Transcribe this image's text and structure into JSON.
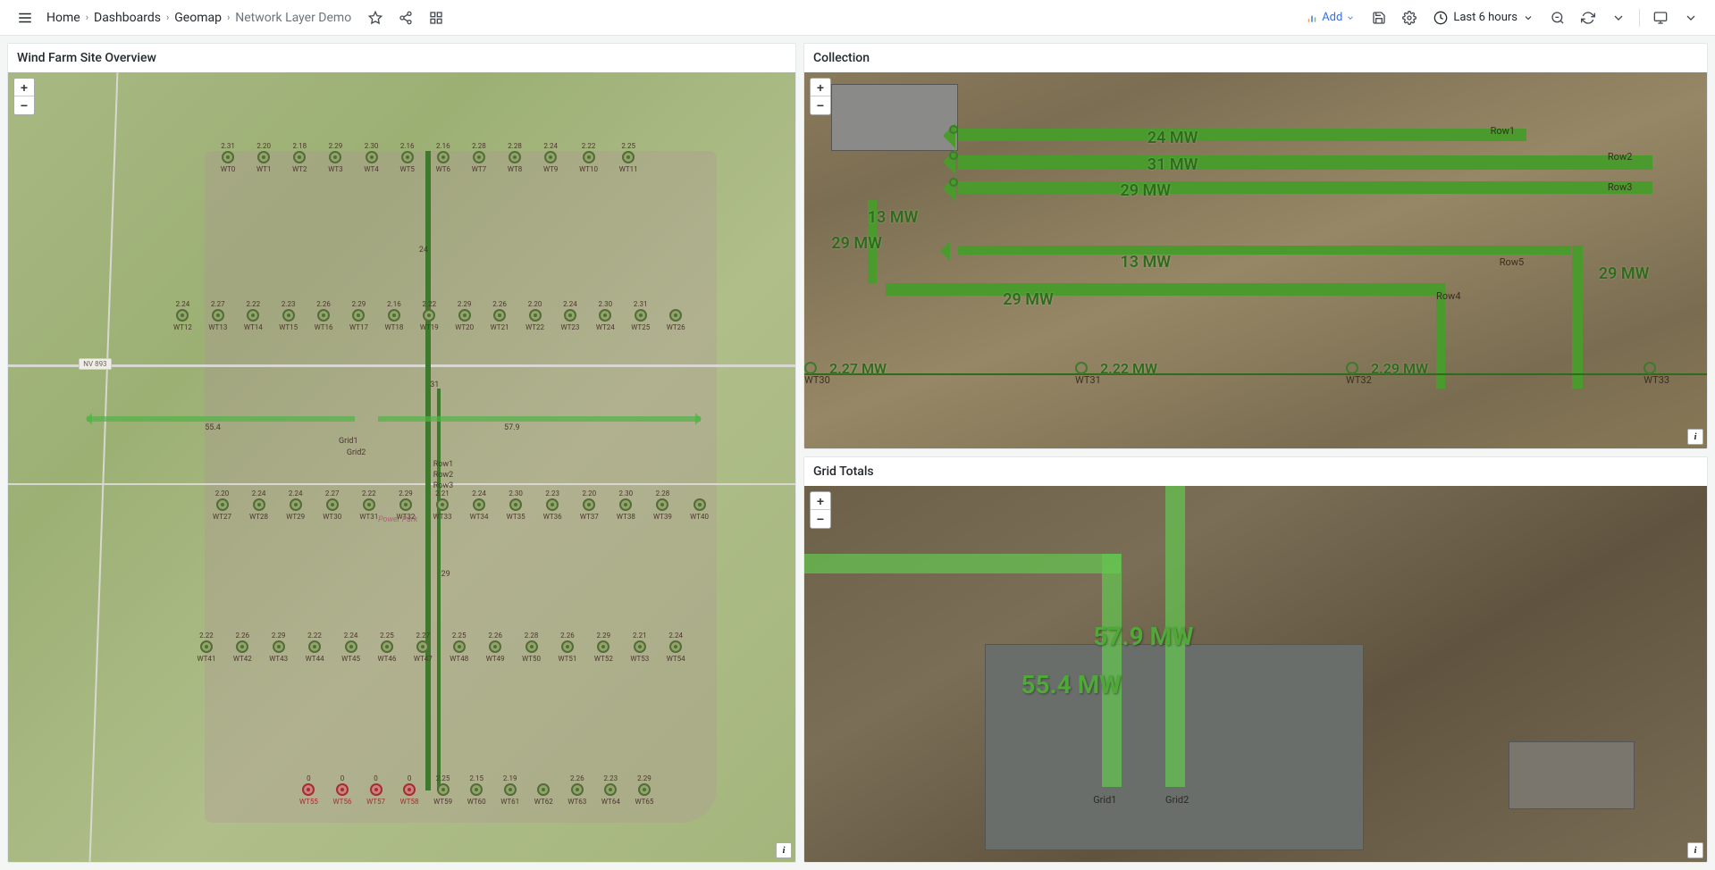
{
  "breadcrumbs": {
    "home": "Home",
    "dashboards": "Dashboards",
    "geomap": "Geomap",
    "current": "Network Layer Demo"
  },
  "toolbar": {
    "add": "Add",
    "time_range": "Last 6 hours"
  },
  "panels": {
    "overview": {
      "title": "Wind Farm Site Overview",
      "road_label": "NV 893",
      "center_labels": {
        "grid1": "Grid1",
        "grid2": "Grid2",
        "row1": "Row1",
        "row2": "Row2",
        "row3": "Row3",
        "power_park": "Power Park"
      },
      "harrow_left": "55.4",
      "harrow_right": "57.9",
      "vlabels": {
        "a": "24",
        "b": "31",
        "c": "29"
      },
      "rows": [
        {
          "top": "10%",
          "turbines": [
            {
              "lbl": "WT0",
              "val": "2.31"
            },
            {
              "lbl": "WT1",
              "val": "2.20"
            },
            {
              "lbl": "WT2",
              "val": "2.18"
            },
            {
              "lbl": "WT3",
              "val": "2.29"
            },
            {
              "lbl": "WT4",
              "val": "2.30"
            },
            {
              "lbl": "WT5",
              "val": "2.16"
            },
            {
              "lbl": "WT6",
              "val": "2.16"
            },
            {
              "lbl": "WT7",
              "val": "2.28"
            },
            {
              "lbl": "WT8",
              "val": "2.28"
            },
            {
              "lbl": "WT9",
              "val": "2.24"
            },
            {
              "lbl": "WT10",
              "val": "2.22"
            },
            {
              "lbl": "WT11",
              "val": "2.25"
            }
          ],
          "left": "27%",
          "right": "20%"
        },
        {
          "top": "30%",
          "turbines": [
            {
              "lbl": "WT12",
              "val": "2.24"
            },
            {
              "lbl": "WT13",
              "val": "2.27"
            },
            {
              "lbl": "WT14",
              "val": "2.22"
            },
            {
              "lbl": "WT15",
              "val": "2.23"
            },
            {
              "lbl": "WT16",
              "val": "2.26"
            },
            {
              "lbl": "WT17",
              "val": "2.29"
            },
            {
              "lbl": "WT18",
              "val": "2.16"
            },
            {
              "lbl": "WT19",
              "val": "2.22"
            },
            {
              "lbl": "WT20",
              "val": "2.29"
            },
            {
              "lbl": "WT21",
              "val": "2.26"
            },
            {
              "lbl": "WT22",
              "val": "2.20"
            },
            {
              "lbl": "WT23",
              "val": "2.24"
            },
            {
              "lbl": "WT24",
              "val": "2.30"
            },
            {
              "lbl": "WT25",
              "val": "2.31"
            },
            {
              "lbl": "WT26",
              "val": ""
            }
          ],
          "left": "21%",
          "right": "14%"
        },
        {
          "top": "54%",
          "turbines": [
            {
              "lbl": "WT27",
              "val": "2.20"
            },
            {
              "lbl": "WT28",
              "val": "2.24"
            },
            {
              "lbl": "WT29",
              "val": "2.24"
            },
            {
              "lbl": "WT30",
              "val": "2.27"
            },
            {
              "lbl": "WT31",
              "val": "2.22"
            },
            {
              "lbl": "WT32",
              "val": "2.29"
            },
            {
              "lbl": "WT33",
              "val": "2.21"
            },
            {
              "lbl": "WT34",
              "val": "2.24"
            },
            {
              "lbl": "WT35",
              "val": "2.30"
            },
            {
              "lbl": "WT36",
              "val": "2.23"
            },
            {
              "lbl": "WT37",
              "val": "2.20"
            },
            {
              "lbl": "WT38",
              "val": "2.30"
            },
            {
              "lbl": "WT39",
              "val": "2.28"
            },
            {
              "lbl": "WT40",
              "val": ""
            }
          ],
          "left": "26%",
          "right": "11%"
        },
        {
          "top": "72%",
          "turbines": [
            {
              "lbl": "WT41",
              "val": "2.22"
            },
            {
              "lbl": "WT42",
              "val": "2.26"
            },
            {
              "lbl": "WT43",
              "val": "2.29"
            },
            {
              "lbl": "WT44",
              "val": "2.22"
            },
            {
              "lbl": "WT45",
              "val": "2.24"
            },
            {
              "lbl": "WT46",
              "val": "2.25"
            },
            {
              "lbl": "WT47",
              "val": "2.27"
            },
            {
              "lbl": "WT48",
              "val": "2.25"
            },
            {
              "lbl": "WT49",
              "val": "2.26"
            },
            {
              "lbl": "WT50",
              "val": "2.28"
            },
            {
              "lbl": "WT51",
              "val": "2.26"
            },
            {
              "lbl": "WT52",
              "val": "2.29"
            },
            {
              "lbl": "WT53",
              "val": "2.21"
            },
            {
              "lbl": "WT54",
              "val": "2.24"
            }
          ],
          "left": "24%",
          "right": "14%"
        },
        {
          "top": "90%",
          "turbines": [
            {
              "lbl": "WT55",
              "val": "0",
              "red": true
            },
            {
              "lbl": "WT56",
              "val": "0",
              "red": true
            },
            {
              "lbl": "WT57",
              "val": "0",
              "red": true
            },
            {
              "lbl": "WT58",
              "val": "0",
              "red": true
            },
            {
              "lbl": "WT59",
              "val": "2.25"
            },
            {
              "lbl": "WT60",
              "val": "2.15"
            },
            {
              "lbl": "WT61",
              "val": "2.19"
            },
            {
              "lbl": "WT62",
              "val": ""
            },
            {
              "lbl": "WT63",
              "val": "2.26"
            },
            {
              "lbl": "WT64",
              "val": "2.23"
            },
            {
              "lbl": "WT65",
              "val": "2.29"
            }
          ],
          "left": "37%",
          "right": "18%",
          "half_red": true
        }
      ]
    },
    "collection": {
      "title": "Collection",
      "flows": [
        {
          "label": "24 MW",
          "top": "15%",
          "left": "38%"
        },
        {
          "label": "31 MW",
          "top": "22%",
          "left": "38%"
        },
        {
          "label": "29 MW",
          "top": "29%",
          "left": "35%"
        },
        {
          "label": "13 MW",
          "top": "36%",
          "left": "7%"
        },
        {
          "label": "29 MW",
          "top": "43%",
          "left": "3%"
        },
        {
          "label": "13 MW",
          "top": "48%",
          "left": "35%"
        },
        {
          "label": "29 MW",
          "top": "58%",
          "left": "22%"
        },
        {
          "label": "29 MW",
          "top": "51%",
          "left": "88%"
        }
      ],
      "row_tags": [
        {
          "t": "Row1",
          "top": "14%",
          "left": "76%"
        },
        {
          "t": "Row2",
          "top": "21%",
          "left": "89%"
        },
        {
          "t": "Row3",
          "top": "29%",
          "left": "89%"
        },
        {
          "t": "Row5",
          "top": "49%",
          "left": "77%"
        },
        {
          "t": "Row4",
          "top": "58%",
          "left": "70%"
        }
      ],
      "bottom_row": [
        {
          "lbl": "WT30",
          "val": "2.27 MW",
          "left": "0%"
        },
        {
          "lbl": "WT31",
          "val": "2.22 MW",
          "left": "30%"
        },
        {
          "lbl": "WT32",
          "val": "2.29 MW",
          "left": "60%"
        },
        {
          "lbl": "WT33",
          "val": "",
          "left": "93%"
        }
      ]
    },
    "grid_totals": {
      "title": "Grid Totals",
      "flows": [
        {
          "label": "57.9 MW",
          "top": "36%",
          "left": "32%"
        },
        {
          "label": "55.4 MW",
          "top": "49%",
          "left": "24%"
        }
      ],
      "grids": [
        {
          "t": "Grid1",
          "left": "32%"
        },
        {
          "t": "Grid2",
          "left": "40%"
        }
      ]
    }
  }
}
